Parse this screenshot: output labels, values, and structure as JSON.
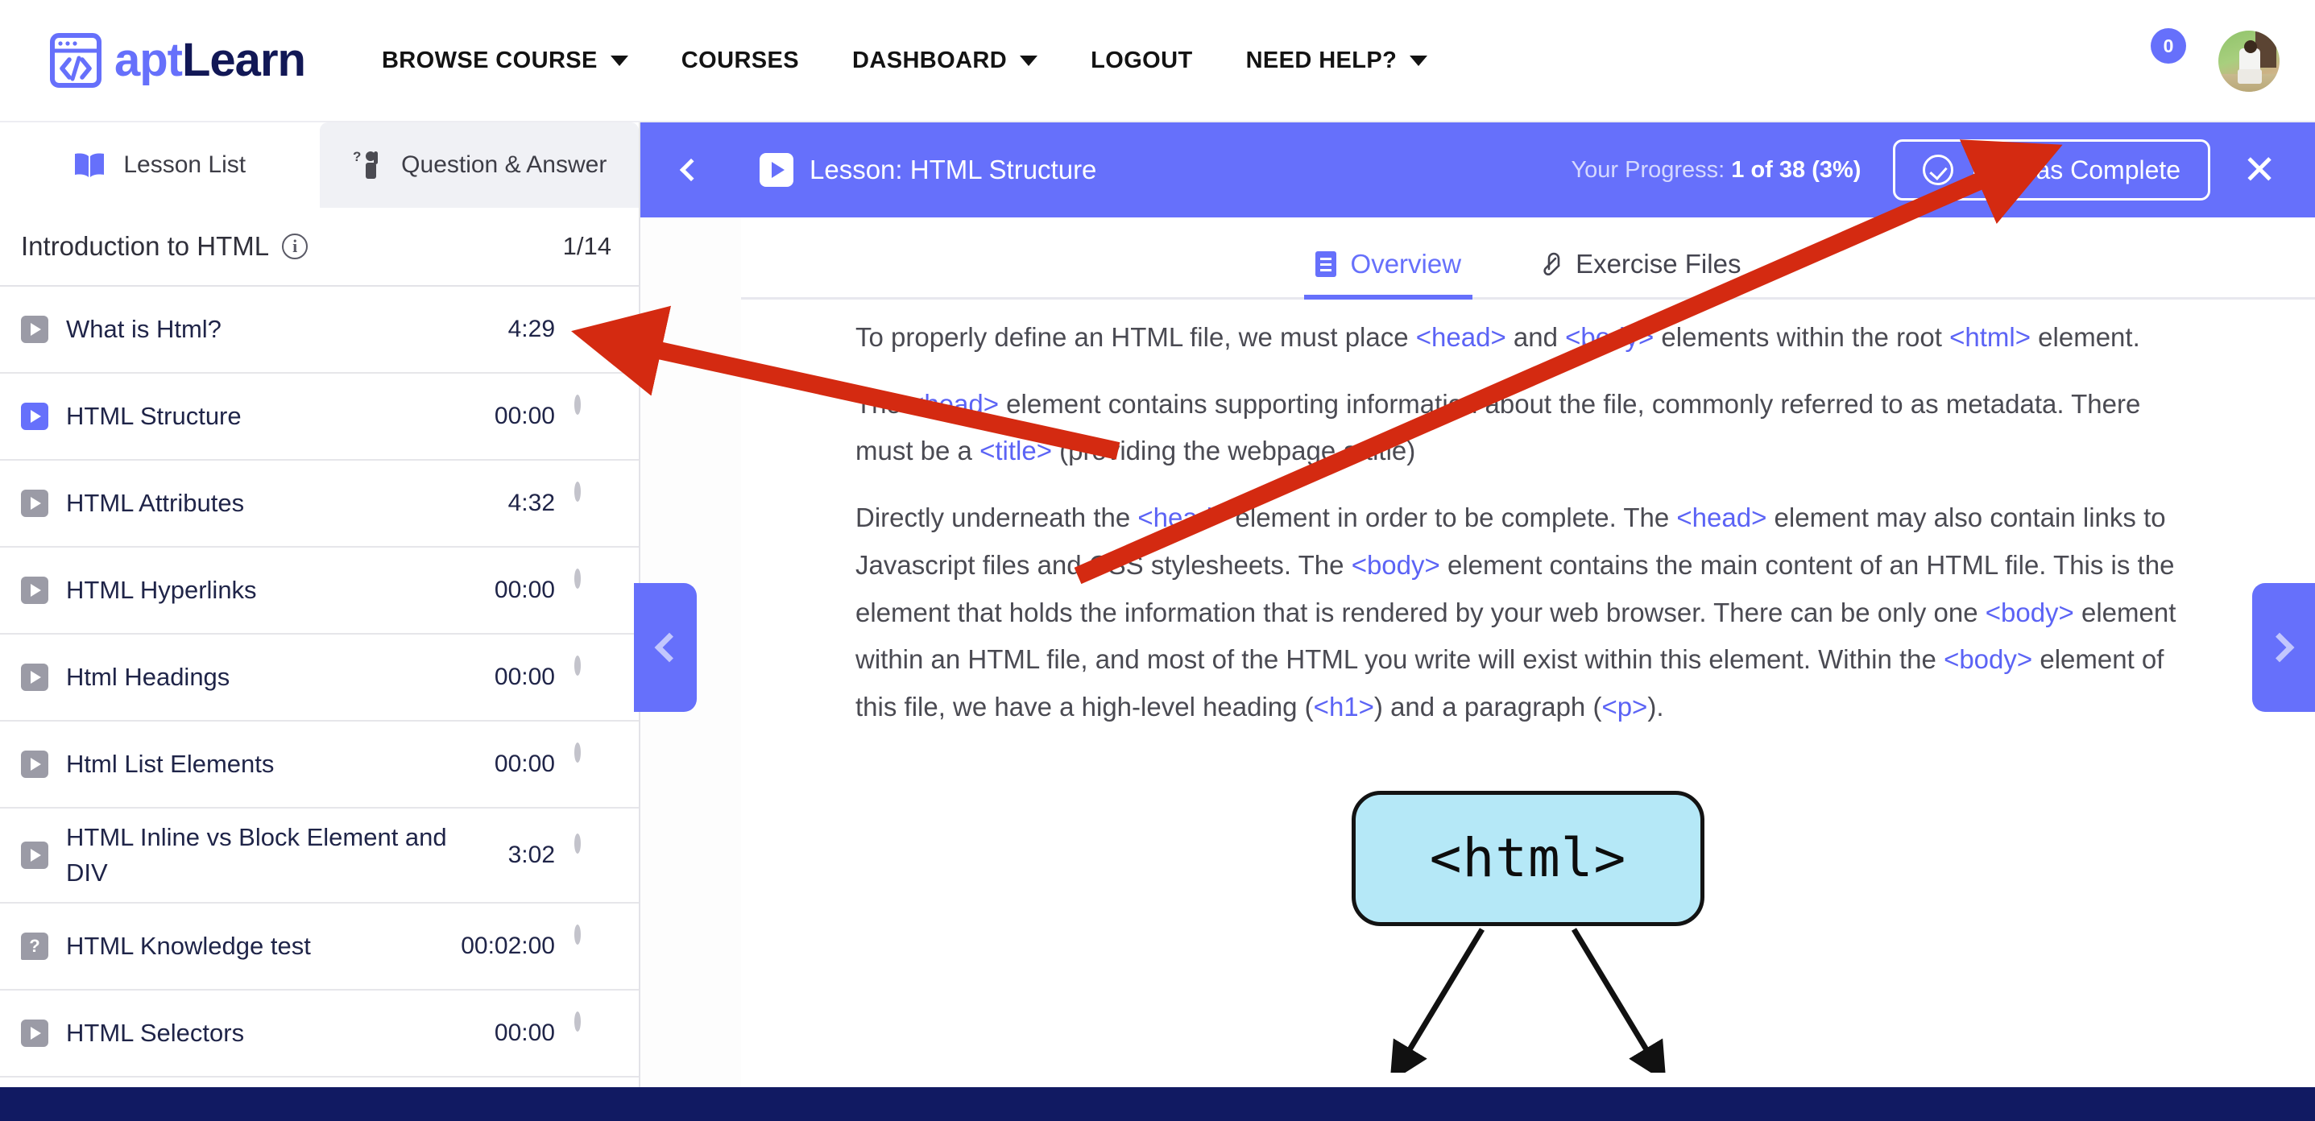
{
  "brand": {
    "apt": "apt",
    "learn": "Learn",
    "icon": "code-window-icon"
  },
  "topnav": {
    "items": [
      {
        "label": "BROWSE COURSE",
        "caret": true
      },
      {
        "label": "COURSES",
        "caret": false
      },
      {
        "label": "DASHBOARD",
        "caret": true
      },
      {
        "label": "LOGOUT",
        "caret": false
      },
      {
        "label": "NEED HELP?",
        "caret": true
      }
    ],
    "notification_count": "0",
    "avatar": "user-avatar"
  },
  "left_panel": {
    "tabs": [
      {
        "label": "Lesson List",
        "icon": "book-icon",
        "active": true
      },
      {
        "label": "Question & Answer",
        "icon": "raised-hand-question-icon",
        "active": false
      }
    ],
    "section": {
      "title": "Introduction to HTML",
      "info_icon": "info-icon",
      "count": "1/14"
    },
    "lessons": [
      {
        "title": "What is Html?",
        "time": "4:29",
        "icon": "video-play-icon",
        "state": "completed",
        "active": false
      },
      {
        "title": "HTML Structure",
        "time": "00:00",
        "icon": "video-play-icon",
        "state": "incomplete",
        "active": true
      },
      {
        "title": "HTML Attributes",
        "time": "4:32",
        "icon": "video-play-icon",
        "state": "incomplete",
        "active": false
      },
      {
        "title": "HTML Hyperlinks",
        "time": "00:00",
        "icon": "video-play-icon",
        "state": "incomplete",
        "active": false
      },
      {
        "title": "Html Headings",
        "time": "00:00",
        "icon": "video-play-icon",
        "state": "incomplete",
        "active": false
      },
      {
        "title": "Html List Elements",
        "time": "00:00",
        "icon": "video-play-icon",
        "state": "incomplete",
        "active": false
      },
      {
        "title": "HTML Inline vs Block Element and DIV",
        "time": "3:02",
        "icon": "video-play-icon",
        "state": "incomplete",
        "active": false
      },
      {
        "title": "HTML Knowledge test",
        "time": "00:02:00",
        "icon": "quiz-icon",
        "state": "incomplete",
        "active": false
      },
      {
        "title": "HTML Selectors",
        "time": "00:00",
        "icon": "video-play-icon",
        "state": "incomplete",
        "active": false
      }
    ]
  },
  "lesson": {
    "back_icon": "back-chevron-icon",
    "play_icon": "video-play-icon",
    "title": "Lesson: HTML Structure",
    "progress_label": "Your Progress: ",
    "progress_value": "1 of 38 (3%)",
    "mark_complete_label": "Mark as Complete",
    "mark_complete_icon": "check-circle-icon",
    "close_icon": "close-icon",
    "tabs": [
      {
        "label": "Overview",
        "icon": "document-icon",
        "active": true
      },
      {
        "label": "Exercise Files",
        "icon": "paperclip-icon",
        "active": false
      }
    ],
    "paragraphs": [
      [
        {
          "t": "To properly define an HTML file, we must place "
        },
        {
          "t": "<head>",
          "code": true
        },
        {
          "t": " and "
        },
        {
          "t": "<body>",
          "code": true
        },
        {
          "t": " elements within the root "
        },
        {
          "t": "<html>",
          "code": true
        },
        {
          "t": " element."
        }
      ],
      [
        {
          "t": "The "
        },
        {
          "t": "<head>",
          "code": true
        },
        {
          "t": " element contains supporting information about the file, commonly referred to as metadata. There must be a "
        },
        {
          "t": "<title>",
          "code": true
        },
        {
          "t": " (providing the webpage a title)"
        }
      ],
      [
        {
          "t": "Directly underneath the "
        },
        {
          "t": "<head>",
          "code": true
        },
        {
          "t": " element in order to be complete. The "
        },
        {
          "t": "<head>",
          "code": true
        },
        {
          "t": " element may also contain links to Javascript files and CSS stylesheets. The "
        },
        {
          "t": "<body>",
          "code": true
        },
        {
          "t": " element contains the main content of an HTML file. This is the element that holds the information that is rendered by your web browser. There can be only one "
        },
        {
          "t": "<body>",
          "code": true
        },
        {
          "t": " element within an HTML file, and most of the HTML you write will exist within this element. Within the "
        },
        {
          "t": "<body>",
          "code": true
        },
        {
          "t": " element of this file, we have a high-level heading ("
        },
        {
          "t": "<h1>",
          "code": true
        },
        {
          "t": ") and a paragraph ("
        },
        {
          "t": "<p>",
          "code": true
        },
        {
          "t": ")."
        }
      ]
    ],
    "diagram": {
      "root_node": "<html>"
    }
  },
  "side_tabs": {
    "left": {
      "icon": "chevron-left-icon"
    },
    "right": {
      "icon": "chevron-right-icon"
    }
  },
  "colors": {
    "accent": "#6670fb",
    "brand_dark": "#121856",
    "footer": "#111a62",
    "annotation": "#d42a11",
    "diagram_node": "#b5e8f7"
  }
}
